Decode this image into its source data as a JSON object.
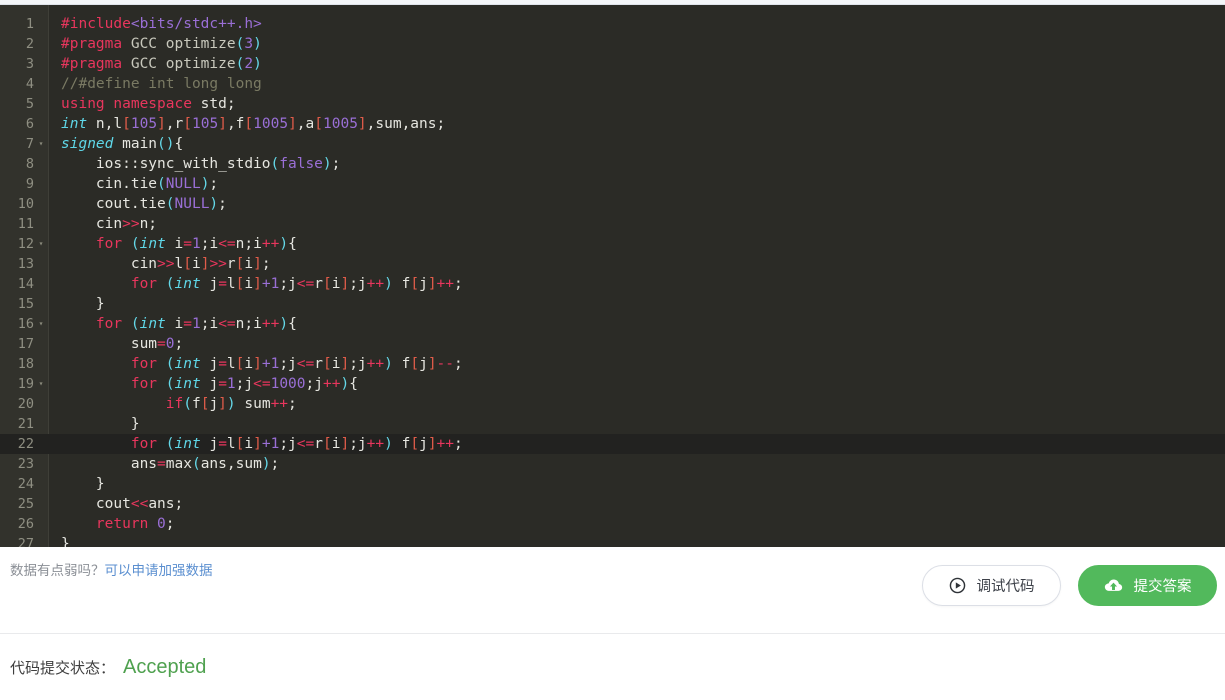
{
  "editor": {
    "language": "cpp",
    "active_line": 22,
    "total_lines": 27,
    "lines": [
      {
        "n": "1",
        "fold": false
      },
      {
        "n": "2",
        "fold": false
      },
      {
        "n": "3",
        "fold": false
      },
      {
        "n": "4",
        "fold": false
      },
      {
        "n": "5",
        "fold": false
      },
      {
        "n": "6",
        "fold": false
      },
      {
        "n": "7",
        "fold": true
      },
      {
        "n": "8",
        "fold": false
      },
      {
        "n": "9",
        "fold": false
      },
      {
        "n": "10",
        "fold": false
      },
      {
        "n": "11",
        "fold": false
      },
      {
        "n": "12",
        "fold": true
      },
      {
        "n": "13",
        "fold": false
      },
      {
        "n": "14",
        "fold": false
      },
      {
        "n": "15",
        "fold": false
      },
      {
        "n": "16",
        "fold": true
      },
      {
        "n": "17",
        "fold": false
      },
      {
        "n": "18",
        "fold": false
      },
      {
        "n": "19",
        "fold": true
      },
      {
        "n": "20",
        "fold": false
      },
      {
        "n": "21",
        "fold": false
      },
      {
        "n": "22",
        "fold": false
      },
      {
        "n": "23",
        "fold": false
      },
      {
        "n": "24",
        "fold": false
      },
      {
        "n": "25",
        "fold": false
      },
      {
        "n": "26",
        "fold": false
      },
      {
        "n": "27",
        "fold": false
      }
    ],
    "source_text": [
      "#include<bits/stdc++.h>",
      "#pragma GCC optimize(3)",
      "#pragma GCC optimize(2)",
      "//#define int long long",
      "using namespace std;",
      "int n,l[105],r[105],f[1005],a[1005],sum,ans;",
      "signed main(){",
      "    ios::sync_with_stdio(false);",
      "    cin.tie(NULL);",
      "    cout.tie(NULL);",
      "    cin>>n;",
      "    for (int i=1;i<=n;i++){",
      "        cin>>l[i]>>r[i];",
      "        for (int j=l[i]+1;j<=r[i];j++) f[j]++;",
      "    }",
      "    for (int i=1;i<=n;i++){",
      "        sum=0;",
      "        for (int j=l[i]+1;j<=r[i];j++) f[j]--;",
      "        for (int j=1;j<=1000;j++){",
      "            if(f[j]) sum++;",
      "        }",
      "        for (int j=l[i]+1;j<=r[i];j++) f[j]++;",
      "        ans=max(ans,sum);",
      "    }",
      "    cout<<ans;",
      "    return 0;",
      "}"
    ]
  },
  "note": {
    "prompt": "数据有点弱吗？",
    "link_label": "可以申请加强数据"
  },
  "actions": {
    "debug_label": "调试代码",
    "debug_icon": "play-circle-icon",
    "submit_label": "提交答案",
    "submit_icon": "cloud-upload-icon",
    "submit_color": "#52b95c"
  },
  "status": {
    "label": "代码提交状态：",
    "value": "Accepted",
    "value_color": "#4fa14f"
  }
}
